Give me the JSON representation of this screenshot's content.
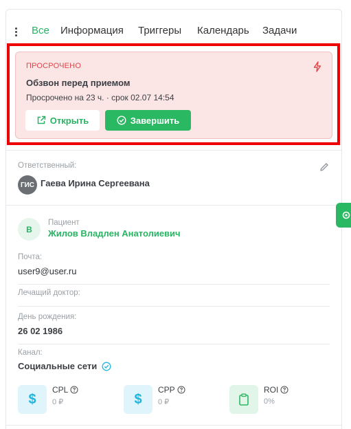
{
  "tabs": [
    "Все",
    "Информация",
    "Триггеры",
    "Календарь",
    "Задачи"
  ],
  "overdue": {
    "label": "ПРОСРОЧЕНО",
    "title": "Обзвон перед приемом",
    "subtitle": "Просрочено на 23 ч. · срок 02.07 14:54",
    "open_label": "Открыть",
    "complete_label": "Завершить"
  },
  "responsible": {
    "label": "Ответственный:",
    "initials": "ГИС",
    "name": "Гаева Ирина Сергеевана"
  },
  "patient": {
    "initial": "В",
    "label": "Пациент",
    "name": "Жилов Владлен Анатолиевич"
  },
  "fields": {
    "email_label": "Почта:",
    "email_value": "user9@user.ru",
    "doctor_label": "Лечащий доктор:",
    "birthday_label": "День рождения:",
    "birthday_value": "26 02 1986",
    "channel_label": "Канал:",
    "channel_value": "Социальные сети"
  },
  "metrics": [
    {
      "name": "CPL",
      "value": "0 ₽",
      "icon": "dollar-icon"
    },
    {
      "name": "CPP",
      "value": "0 ₽",
      "icon": "dollar-icon"
    },
    {
      "name": "ROI",
      "value": "0%",
      "icon": "clipboard-icon"
    }
  ],
  "colors": {
    "accent": "#28b463",
    "danger": "#e0454a",
    "overdue_bg": "#fbe5e5",
    "highlight": "#ee0000"
  }
}
